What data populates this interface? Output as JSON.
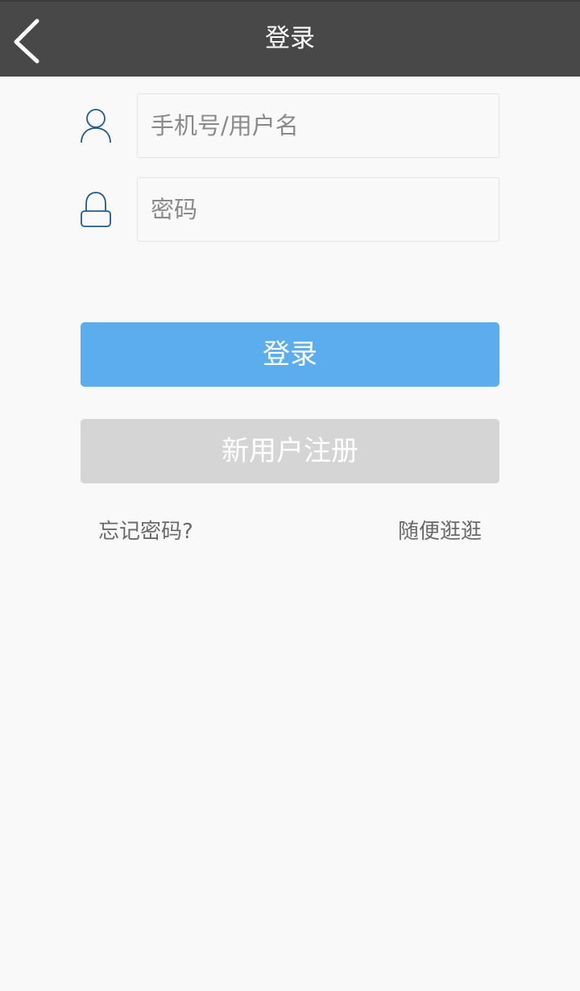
{
  "header": {
    "title": "登录",
    "back_icon": "chevron-left-icon"
  },
  "form": {
    "username": {
      "icon": "user-icon",
      "value": "",
      "placeholder": "手机号/用户名"
    },
    "password": {
      "icon": "lock-icon",
      "value": "",
      "placeholder": "密码"
    }
  },
  "buttons": {
    "login_label": "登录",
    "register_label": "新用户注册"
  },
  "links": {
    "forgot_password": "忘记密码?",
    "browse": "随便逛逛"
  },
  "colors": {
    "header_bg": "#484848",
    "page_bg": "#f9f9f9",
    "login_button": "#5badee",
    "register_button": "#d5d5d5",
    "icon_stroke": "#1f5b8f"
  }
}
